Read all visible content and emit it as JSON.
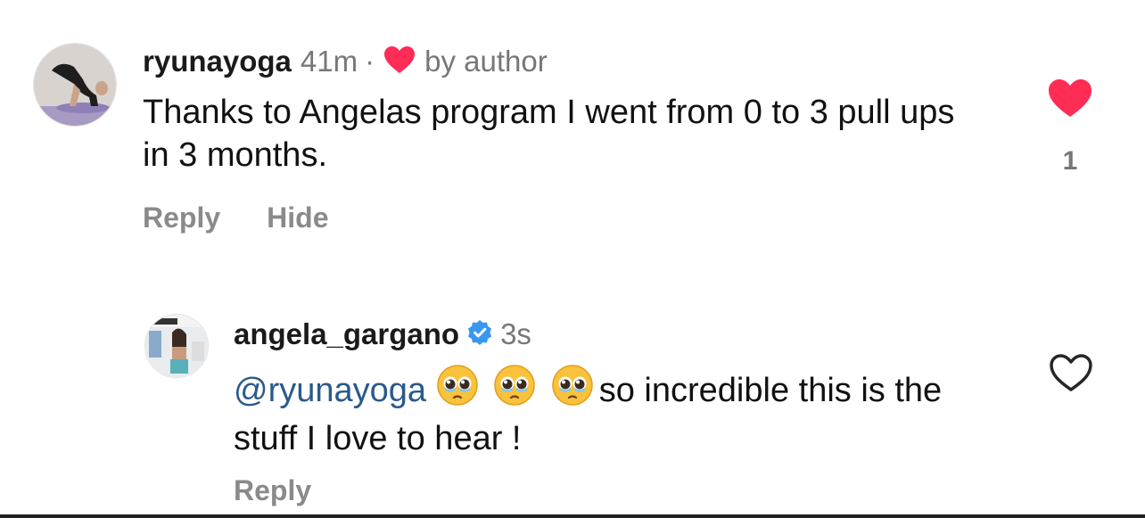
{
  "comments": [
    {
      "username": "ryunayoga",
      "time": "41m",
      "separator": "·",
      "liked_by_author": "by author",
      "text": "Thanks to Angelas program I went from 0 to 3 pull ups in 3 months.",
      "actions": {
        "reply": "Reply",
        "hide": "Hide"
      },
      "liked": true,
      "like_count": "1",
      "colors": {
        "heart": "#ff2d55"
      }
    },
    {
      "username": "angela_gargano",
      "time": "3s",
      "verified": true,
      "mention": "@ryunayoga",
      "emoji": [
        "🥹",
        "🥹",
        "🥹"
      ],
      "text": "so incredible this is the stuff I love to hear !",
      "actions": {
        "reply": "Reply"
      },
      "liked": false,
      "colors": {
        "verified": "#3897f0",
        "mention": "#2b5a8a"
      }
    }
  ]
}
